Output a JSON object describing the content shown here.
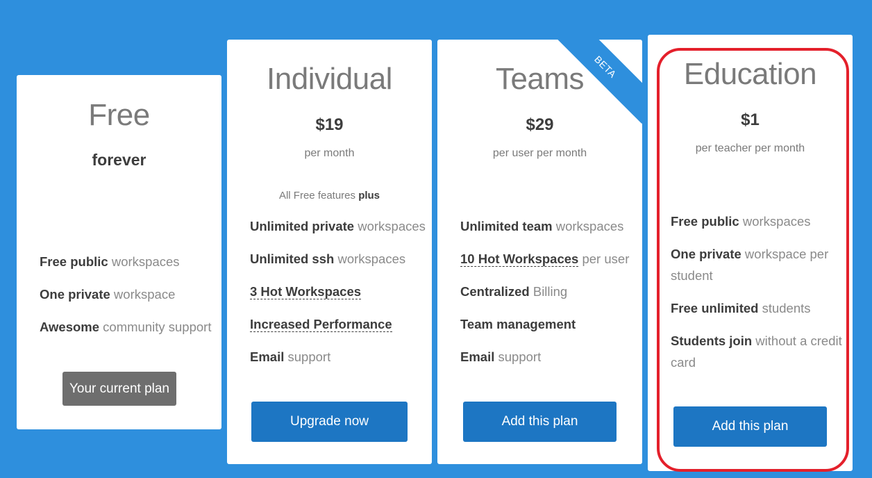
{
  "plans": {
    "free": {
      "title": "Free",
      "subtitle": "forever",
      "features": [
        {
          "bold": "Free public",
          "rest": " workspaces"
        },
        {
          "bold": "One private",
          "rest": " workspace"
        },
        {
          "bold": "Awesome",
          "rest": " community support"
        }
      ],
      "button_label": "Your current plan"
    },
    "individual": {
      "title": "Individual",
      "price": "$19",
      "period": "per month",
      "plus_prefix": "All Free features ",
      "plus_bold": "plus",
      "features": [
        {
          "bold": "Unlimited private",
          "rest": " workspaces"
        },
        {
          "bold": "Unlimited ssh",
          "rest": " workspaces"
        },
        {
          "hot": "3 Hot Workspaces",
          "rest": ""
        },
        {
          "hot": "Increased Performance",
          "rest": ""
        },
        {
          "bold": "Email",
          "rest": " support"
        }
      ],
      "button_label": "Upgrade now"
    },
    "teams": {
      "title": "Teams",
      "ribbon": "BETA",
      "price": "$29",
      "period": "per user per month",
      "features": [
        {
          "bold": "Unlimited team",
          "rest": " workspaces"
        },
        {
          "hot": "10 Hot Workspaces",
          "rest": " per user"
        },
        {
          "bold": "Centralized",
          "rest": " Billing"
        },
        {
          "bold": "Team management",
          "rest": ""
        },
        {
          "bold": "Email",
          "rest": " support"
        }
      ],
      "button_label": "Add this plan"
    },
    "education": {
      "title": "Education",
      "price": "$1",
      "period": "per teacher per month",
      "features": [
        {
          "bold": "Free public",
          "rest": " workspaces"
        },
        {
          "bold": "One private",
          "rest": " workspace per student"
        },
        {
          "bold": "Free unlimited",
          "rest": " students"
        },
        {
          "bold": "Students join",
          "rest": " without a credit card"
        }
      ],
      "button_label": "Add this plan"
    }
  },
  "colors": {
    "background": "#2e8fdd",
    "button_primary": "#1d76c3",
    "button_current": "#6e6e6e",
    "highlight": "#e4202b"
  }
}
